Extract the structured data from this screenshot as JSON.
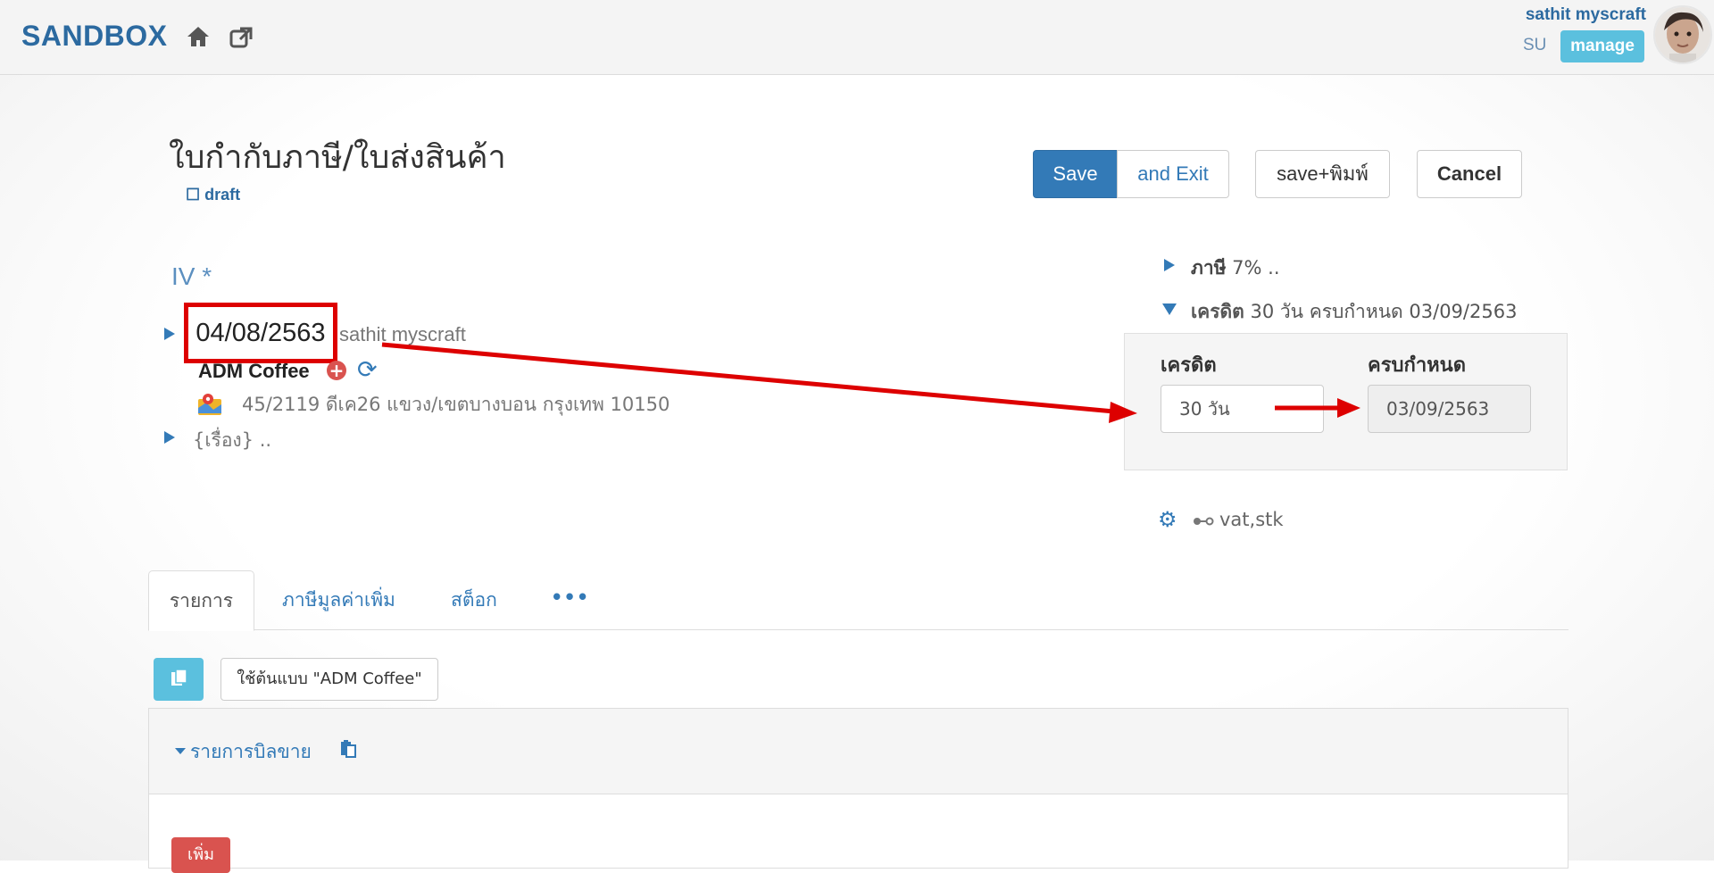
{
  "header": {
    "brand": "SANDBOX",
    "user_name": "sathit myscraft",
    "role": "SU",
    "manage_label": "manage"
  },
  "document": {
    "title": "ใบกำกับภาษี/ใบส่งสินค้า",
    "draft_label": "☐ draft",
    "doc_code": "IV *",
    "date": "04/08/2563",
    "created_by": "sathit myscraft",
    "customer_name": "ADM Coffee",
    "customer_address": "45/2119 ดีเค26 แขวง/เขตบางบอน กรุงเทพ 10150",
    "subject_placeholder": "{เรื่อง} .."
  },
  "actions": {
    "save": "Save",
    "save_exit": "and Exit",
    "save_print": "save+พิมพ์",
    "cancel": "Cancel"
  },
  "side": {
    "vat_title": "ภาษี",
    "vat_value": "7% ..",
    "credit_title": "เครดิต",
    "credit_summary": "30 วัน ครบกำหนด",
    "due_summary": "03/09/2563",
    "credit_label": "เครดิต",
    "due_label": "ครบกำหนด",
    "credit_value": "30 วัน",
    "due_value": "03/09/2563",
    "flags": "vat,stk"
  },
  "tabs": [
    {
      "label": "รายการ",
      "active": true
    },
    {
      "label": "ภาษีมูลค่าเพิ่ม",
      "active": false
    },
    {
      "label": "สต็อก",
      "active": false
    },
    {
      "label": "•••",
      "active": false
    }
  ],
  "items": {
    "template_button": "ใช้ต้นแบบ \"ADM Coffee\"",
    "section_title": "รายการบิลขาย",
    "add_button": "เพิ่ม"
  },
  "colors": {
    "primary": "#337ab7",
    "info": "#5bc0de",
    "danger": "#d9534f",
    "annotation_red": "#dd0000"
  }
}
